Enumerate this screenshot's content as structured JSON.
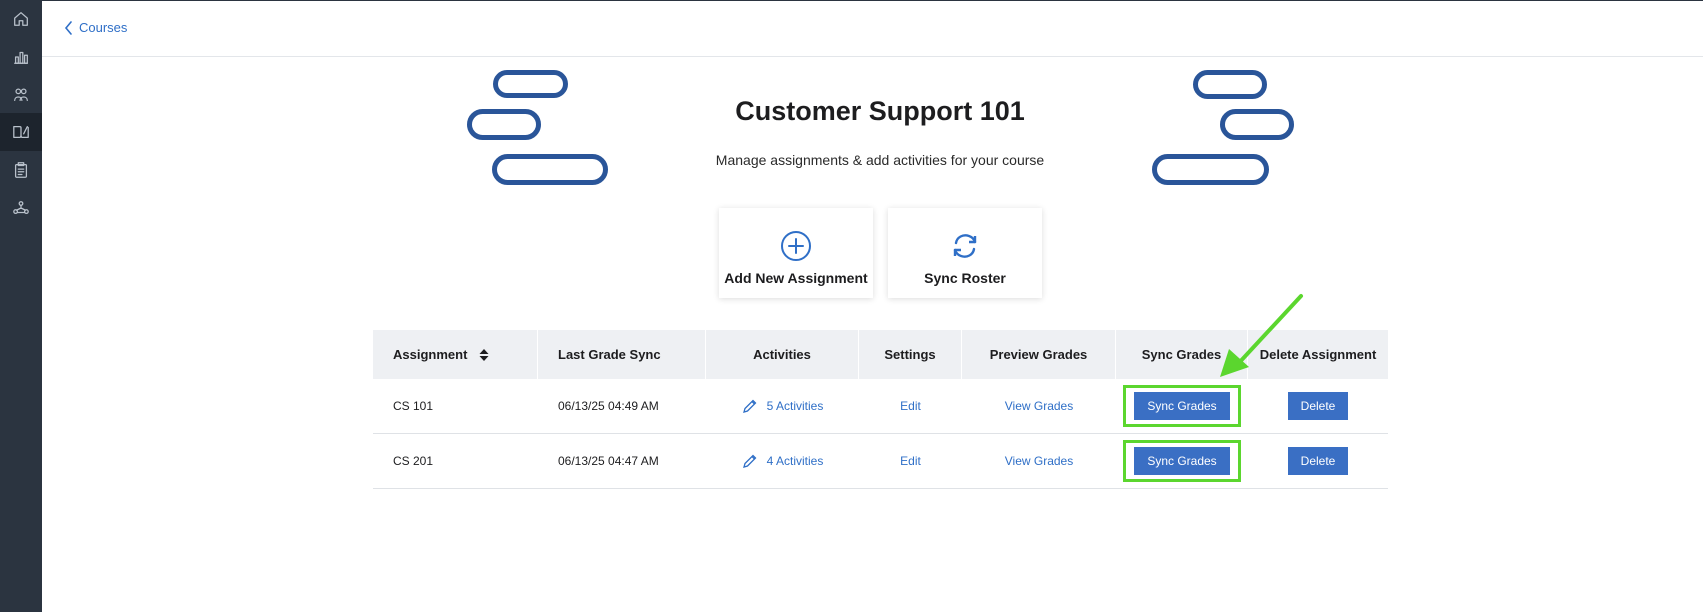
{
  "nav": {
    "back_label": "Courses",
    "sidebar_icons": [
      "home-icon",
      "bar-chart-icon",
      "users-icon",
      "book-icon",
      "clipboard-icon",
      "network-icon"
    ],
    "active_index": 3
  },
  "header": {
    "title": "Customer Support 101",
    "subtitle": "Manage assignments & add activities for your course"
  },
  "actions": {
    "add_assignment": "Add New Assignment",
    "sync_roster": "Sync Roster"
  },
  "table": {
    "headers": {
      "assignment": "Assignment",
      "last_grade_sync": "Last Grade Sync",
      "activities": "Activities",
      "settings": "Settings",
      "preview_grades": "Preview Grades",
      "sync_grades": "Sync Grades",
      "delete_assignment": "Delete Assignment"
    },
    "rows": [
      {
        "name": "CS 101",
        "last_sync": "06/13/25 04:49 AM",
        "activities": "5 Activities",
        "settings": "Edit",
        "preview": "View Grades",
        "sync": "Sync Grades",
        "delete": "Delete"
      },
      {
        "name": "CS 201",
        "last_sync": "06/13/25 04:47 AM",
        "activities": "4 Activities",
        "settings": "Edit",
        "preview": "View Grades",
        "sync": "Sync Grades",
        "delete": "Delete"
      }
    ]
  },
  "colors": {
    "sidebar": "#2b3440",
    "accent": "#2f6fc7",
    "button": "#3a6fc4",
    "highlight": "#5bd62e",
    "pill": "#2a5599"
  }
}
